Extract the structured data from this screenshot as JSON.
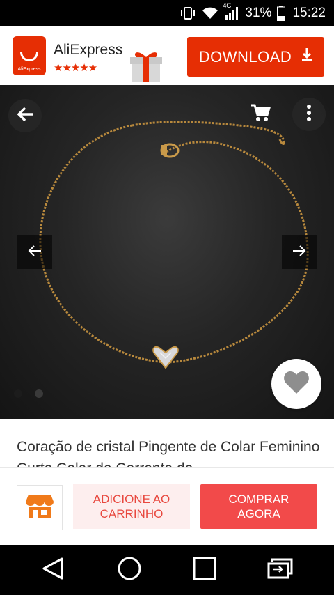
{
  "status_bar": {
    "network": "4G",
    "battery": "31%",
    "time": "15:22"
  },
  "ad_banner": {
    "app_name": "AliExpress",
    "logo_text": "AliExpress",
    "rating_stars": "★★★★★",
    "download_label": "DOWNLOAD"
  },
  "product": {
    "title": "Coração de cristal Pingente de Colar Feminino Curto Colar de Corrente de",
    "image_count": 2,
    "active_image": 2
  },
  "actions": {
    "add_to_cart_label": "ADICIONE AO CARRINHO",
    "buy_now_label": "COMPRAR AGORA"
  },
  "colors": {
    "brand": "#e62e04",
    "buy_button": "#f24a4a",
    "store_icon": "#f07a1a"
  },
  "icons": [
    "back-arrow-icon",
    "cart-icon",
    "more-vert-icon",
    "chevron-left-icon",
    "chevron-right-icon",
    "heart-icon",
    "store-icon",
    "download-icon",
    "gift-icon"
  ]
}
